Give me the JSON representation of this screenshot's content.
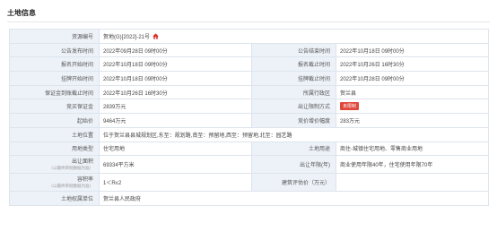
{
  "page": {
    "title": "土地信息"
  },
  "colors": {
    "label_bg": "#edf2f8",
    "border": "#dde4ec",
    "accent_red": "#e0463a"
  },
  "fields": {
    "resource_no_label": "资源编号",
    "resource_no_value": "贺地(G)[2022]-21号",
    "resource_no_icon": "house-icon",
    "announce_start_label": "公告发布时间",
    "announce_start_value": "2022年09月28日 09时00分",
    "announce_end_label": "公告结束时间",
    "announce_end_value": "2022年10月18日 09时00分",
    "signup_start_label": "报名开始时间",
    "signup_start_value": "2022年10月18日 09时00分",
    "signup_end_label": "报名截止时间",
    "signup_end_value": "2022年10月26日 16时30分",
    "listing_start_label": "挂牌开始时间",
    "listing_start_value": "2022年10月18日 09时00分",
    "listing_end_label": "挂牌截止时间",
    "listing_end_value": "2022年10月28日 09时00分",
    "deposit_deadline_label": "保证金到账截止时间",
    "deposit_deadline_value": "2022年10月26日 16时30分",
    "district_label": "所属行政区",
    "district_value": "贺兰县",
    "bid_deposit_label": "竞买保证金",
    "bid_deposit_value": "2839万元",
    "restriction_label": "出让限制方式",
    "restriction_value": "未限制",
    "start_price_label": "起始价",
    "start_price_value": "9464万元",
    "increment_label": "竞价增价幅度",
    "increment_value": "283万元",
    "location_label": "土地位置",
    "location_value": "位于贺兰县县城规划区,东至：规划路,南至：预留地,西至：预留地,北至：园艺路",
    "land_type_label": "用地类型",
    "land_type_value": "住宅用地",
    "land_use_label": "土地用途",
    "land_use_value": "商住-城镇住宅用地、零售商业用地",
    "area_label_sub": "出让面积",
    "area_label_note": "（以最终审批数据为准）",
    "area_value": "69334平方米",
    "years_label": "出让年限(年)",
    "years_value": "商业使用年限40年，住宅使用年限70年",
    "plot_ratio_label": "容积率",
    "plot_ratio_note": "（以最终审批数据为准）",
    "plot_ratio_value": "1＜R≤2",
    "valuation_label": "建筑评估价（万元）",
    "valuation_value": "",
    "owner_label": "土地权属单位",
    "owner_value": "贺兰县人民政府"
  }
}
